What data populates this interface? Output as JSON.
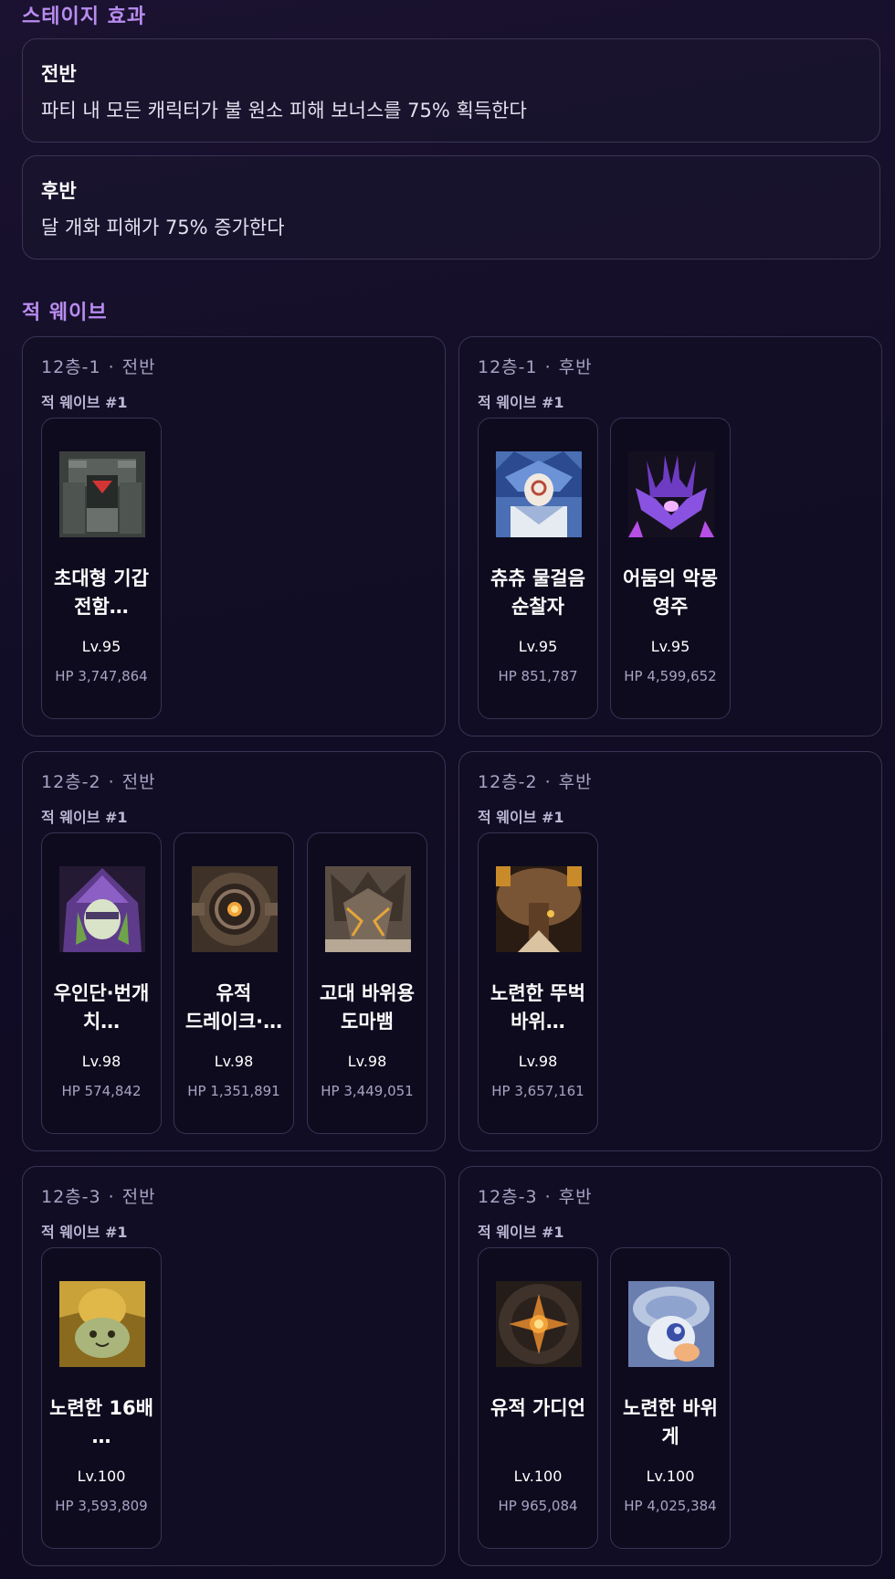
{
  "stage_effects": {
    "title": "스테이지 효과",
    "first_half": {
      "title": "전반",
      "description": "파티 내 모든 캐릭터가 불 원소 피해 보너스를 75% 획득한다"
    },
    "second_half": {
      "title": "후반",
      "description": "달 개화 피해가 75% 증가한다"
    }
  },
  "enemy_waves": {
    "title": "적 웨이브",
    "panels": [
      {
        "chamber": "12층-1",
        "half": "전반",
        "wave_label": "적 웨이브 #1",
        "enemies": [
          {
            "name": "초대형 기갑 전함…",
            "level": "Lv.95",
            "hp": "HP 3,747,864",
            "portrait": "mech-warship-portrait"
          }
        ]
      },
      {
        "chamber": "12층-1",
        "half": "후반",
        "wave_label": "적 웨이브 #1",
        "enemies": [
          {
            "name": "츄츄 물걸음 순찰자",
            "level": "Lv.95",
            "hp": "HP 851,787",
            "portrait": "hydro-patroller-portrait"
          },
          {
            "name": "어둠의 악몽 영주",
            "level": "Lv.95",
            "hp": "HP 4,599,652",
            "portrait": "dark-lord-portrait"
          }
        ]
      },
      {
        "chamber": "12층-2",
        "half": "전반",
        "wave_label": "적 웨이브 #1",
        "enemies": [
          {
            "name": "우인단·번개 치…",
            "level": "Lv.98",
            "hp": "HP 574,842",
            "portrait": "fatui-electro-portrait"
          },
          {
            "name": "유적 드레이크·…",
            "level": "Lv.98",
            "hp": "HP 1,351,891",
            "portrait": "ruin-drake-portrait"
          },
          {
            "name": "고대 바위용 도마뱀",
            "level": "Lv.98",
            "hp": "HP 3,449,051",
            "portrait": "geo-lizard-portrait"
          }
        ]
      },
      {
        "chamber": "12층-2",
        "half": "후반",
        "wave_label": "적 웨이브 #1",
        "enemies": [
          {
            "name": "노련한 뚜벅 바위…",
            "level": "Lv.98",
            "hp": "HP 3,657,161",
            "portrait": "geo-walker-portrait"
          }
        ]
      },
      {
        "chamber": "12층-3",
        "half": "전반",
        "wave_label": "적 웨이브 #1",
        "enemies": [
          {
            "name": "노련한 16배 …",
            "level": "Lv.100",
            "hp": "HP 3,593,809",
            "portrait": "golden-crab-portrait"
          }
        ]
      },
      {
        "chamber": "12층-3",
        "half": "후반",
        "wave_label": "적 웨이브 #1",
        "enemies": [
          {
            "name": "유적 가디언",
            "level": "Lv.100",
            "hp": "HP 965,084",
            "portrait": "ruin-guard-portrait"
          },
          {
            "name": "노련한 바위 게",
            "level": "Lv.100",
            "hp": "HP 4,025,384",
            "portrait": "rock-crab-portrait"
          }
        ]
      }
    ]
  },
  "colors": {
    "accent": "#b98cf0",
    "card_border": "#3a3354",
    "muted_text": "#a9a3c4"
  }
}
